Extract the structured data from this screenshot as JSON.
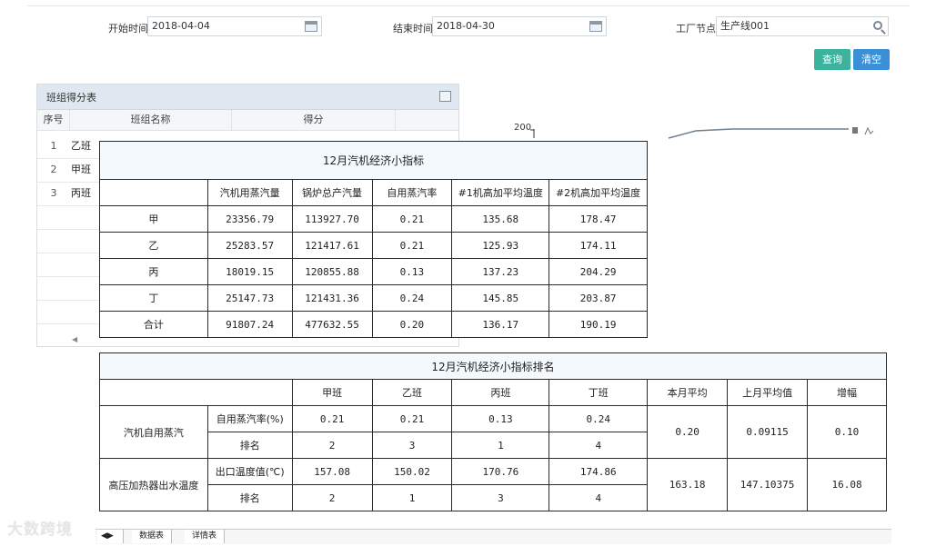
{
  "filters": {
    "start_label": "开始时间",
    "start_value": "2018-04-04",
    "end_label": "结束时间",
    "end_value": "2018-04-30",
    "node_label": "工厂节点",
    "node_value": "生产线001"
  },
  "buttons": {
    "query": "查询",
    "clear": "清空",
    "query_color": "#3db39e",
    "clear_color": "#3b8fd6"
  },
  "panel": {
    "title": "班组得分表",
    "columns": [
      "序号",
      "班组名称",
      "得分"
    ],
    "rows": [
      {
        "num": "1",
        "name": "乙班"
      },
      {
        "num": "2",
        "name": "甲班"
      },
      {
        "num": "3",
        "name": "丙班"
      }
    ]
  },
  "chart": {
    "y_tick": "200"
  },
  "table1": {
    "title": "12月汽机经济小指标",
    "headers": [
      "",
      "汽机用蒸汽量",
      "锅炉总产汽量",
      "自用蒸汽率",
      "#1机高加平均温度",
      "#2机高加平均温度"
    ],
    "rows": [
      [
        "甲",
        "23356.79",
        "113927.70",
        "0.21",
        "135.68",
        "178.47"
      ],
      [
        "乙",
        "25283.57",
        "121417.61",
        "0.21",
        "125.93",
        "174.11"
      ],
      [
        "丙",
        "18019.15",
        "120855.88",
        "0.13",
        "137.23",
        "204.29"
      ],
      [
        "丁",
        "25147.73",
        "121431.36",
        "0.24",
        "145.85",
        "203.87"
      ],
      [
        "合计",
        "91807.24",
        "477632.55",
        "0.20",
        "136.17",
        "190.19"
      ]
    ]
  },
  "table2": {
    "title": "12月汽机经济小指标排名",
    "headers": [
      "甲班",
      "乙班",
      "丙班",
      "丁班",
      "本月平均",
      "上月平均值",
      "增幅"
    ],
    "group1": {
      "name": "汽机自用蒸汽",
      "sub1": "自用蒸汽率(%)",
      "vals1": [
        "0.21",
        "0.21",
        "0.13",
        "0.24"
      ],
      "sub2": "排名",
      "vals2": [
        "2",
        "3",
        "1",
        "4"
      ],
      "avg": "0.20",
      "last": "0.09115",
      "inc": "0.10"
    },
    "group2": {
      "name": "高压加热器出水温度",
      "sub1": "出口温度值(℃)",
      "vals1": [
        "157.08",
        "150.02",
        "170.76",
        "174.86"
      ],
      "sub2": "排名",
      "vals2": [
        "2",
        "1",
        "3",
        "4"
      ],
      "avg": "163.18",
      "last": "147.10375",
      "inc": "16.08"
    }
  },
  "sheet_tabs": [
    "数据表",
    "详情表"
  ],
  "watermark": "大数跨境"
}
